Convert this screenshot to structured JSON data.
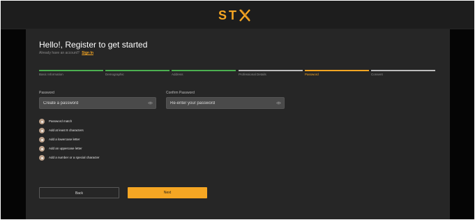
{
  "header": {
    "logo_text": "ST",
    "logo_icon": "x-icon",
    "accent_color": "#f5a623"
  },
  "form": {
    "title": "Hello!, Register to get started",
    "subtitle": "Already have an account?",
    "sign_in_link": "Sign In"
  },
  "steps": [
    {
      "label": "Basic Information",
      "status": "completed",
      "color": "#4caf50"
    },
    {
      "label": "Demographic",
      "status": "completed",
      "color": "#4caf50"
    },
    {
      "label": "Address",
      "status": "completed",
      "color": "#4caf50"
    },
    {
      "label": "Professional Details",
      "status": "completed",
      "color": "#bdbdbd"
    },
    {
      "label": "Password",
      "status": "active",
      "color": "#f5a623"
    },
    {
      "label": "Consent",
      "status": "pending",
      "color": "#bdbdbd"
    }
  ],
  "password": {
    "label": "Password",
    "placeholder": "Create a password",
    "value": ""
  },
  "confirm_password": {
    "label": "Confirm Password",
    "placeholder": "Re-enter your password",
    "value": ""
  },
  "rules": [
    "Password match",
    "Add at least 8 characters",
    "Add a lowercase letter",
    "Add an uppercase letter",
    "Add a number or a special character"
  ],
  "buttons": {
    "back": "Back",
    "next": "Next"
  }
}
